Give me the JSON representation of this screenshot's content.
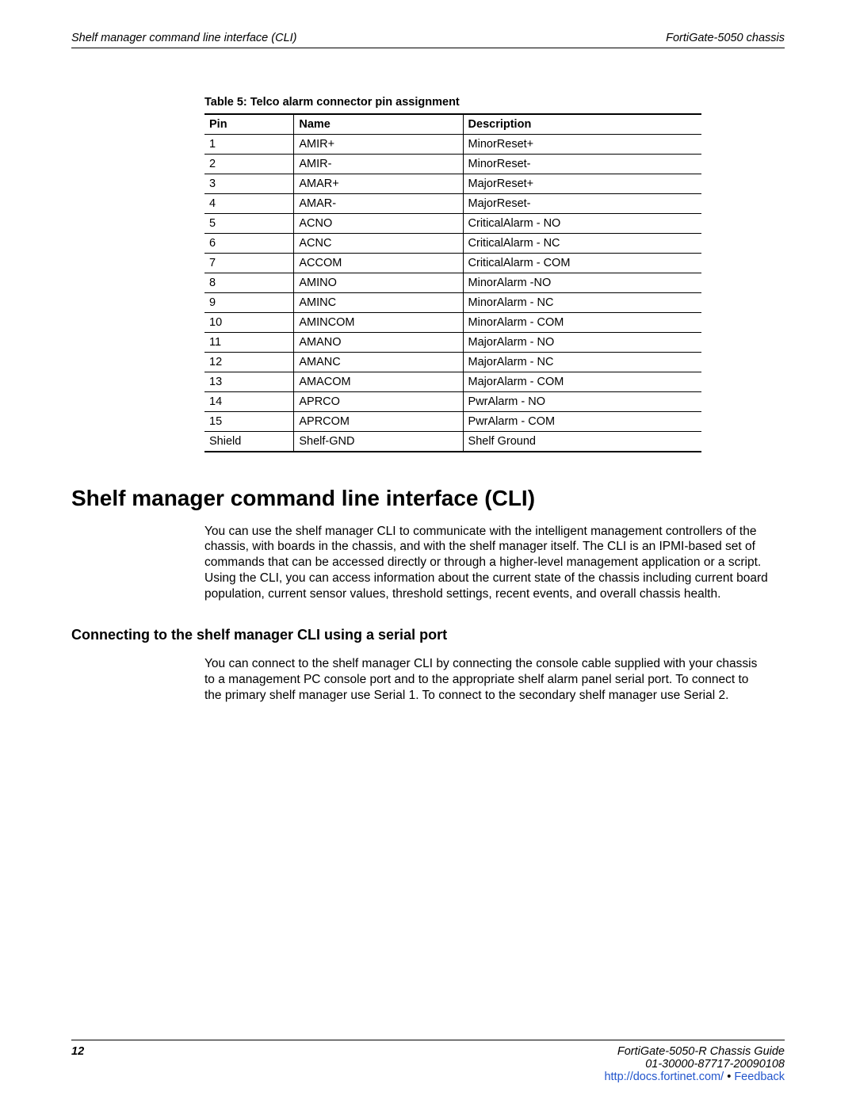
{
  "header": {
    "left": "Shelf manager command line interface (CLI)",
    "right": "FortiGate-5050 chassis"
  },
  "table": {
    "caption": "Table 5: Telco alarm connector pin assignment",
    "headers": [
      "Pin",
      "Name",
      "Description"
    ],
    "rows": [
      [
        "1",
        "AMIR+",
        "MinorReset+"
      ],
      [
        "2",
        "AMIR-",
        "MinorReset-"
      ],
      [
        "3",
        "AMAR+",
        "MajorReset+"
      ],
      [
        "4",
        "AMAR-",
        "MajorReset-"
      ],
      [
        "5",
        "ACNO",
        "CriticalAlarm - NO"
      ],
      [
        "6",
        "ACNC",
        "CriticalAlarm - NC"
      ],
      [
        "7",
        "ACCOM",
        "CriticalAlarm - COM"
      ],
      [
        "8",
        "AMINO",
        "MinorAlarm -NO"
      ],
      [
        "9",
        "AMINC",
        "MinorAlarm - NC"
      ],
      [
        "10",
        "AMINCOM",
        "MinorAlarm - COM"
      ],
      [
        "11",
        "AMANO",
        "MajorAlarm - NO"
      ],
      [
        "12",
        "AMANC",
        "MajorAlarm - NC"
      ],
      [
        "13",
        "AMACOM",
        "MajorAlarm - COM"
      ],
      [
        "14",
        "APRCO",
        "PwrAlarm - NO"
      ],
      [
        "15",
        "APRCOM",
        "PwrAlarm - COM"
      ],
      [
        "Shield",
        "Shelf-GND",
        "Shelf Ground"
      ]
    ]
  },
  "section": {
    "title": "Shelf manager command line interface (CLI)",
    "para1": "You can use the shelf manager CLI to communicate with the intelligent management controllers of the chassis, with boards in the chassis, and with the shelf manager itself. The CLI is an IPMI-based set of commands that can be accessed directly or through a higher-level management application or a script. Using the CLI, you can access information about the current state of the chassis including current board population, current sensor values, threshold settings, recent events, and overall chassis health.",
    "sub_title": "Connecting to the shelf manager CLI using a serial port",
    "para2": "You can connect to the shelf manager CLI by connecting the console cable supplied with your chassis to a management PC console port and to the appropriate shelf alarm panel serial port. To connect to the primary shelf manager use Serial 1. To connect to the secondary shelf manager use Serial 2."
  },
  "footer": {
    "page": "12",
    "guide": "FortiGate-5050-R   Chassis Guide",
    "docnum": "01-30000-87717-20090108",
    "link1_text": "http://docs.fortinet.com/",
    "sep": " • ",
    "link2_text": "Feedback"
  }
}
